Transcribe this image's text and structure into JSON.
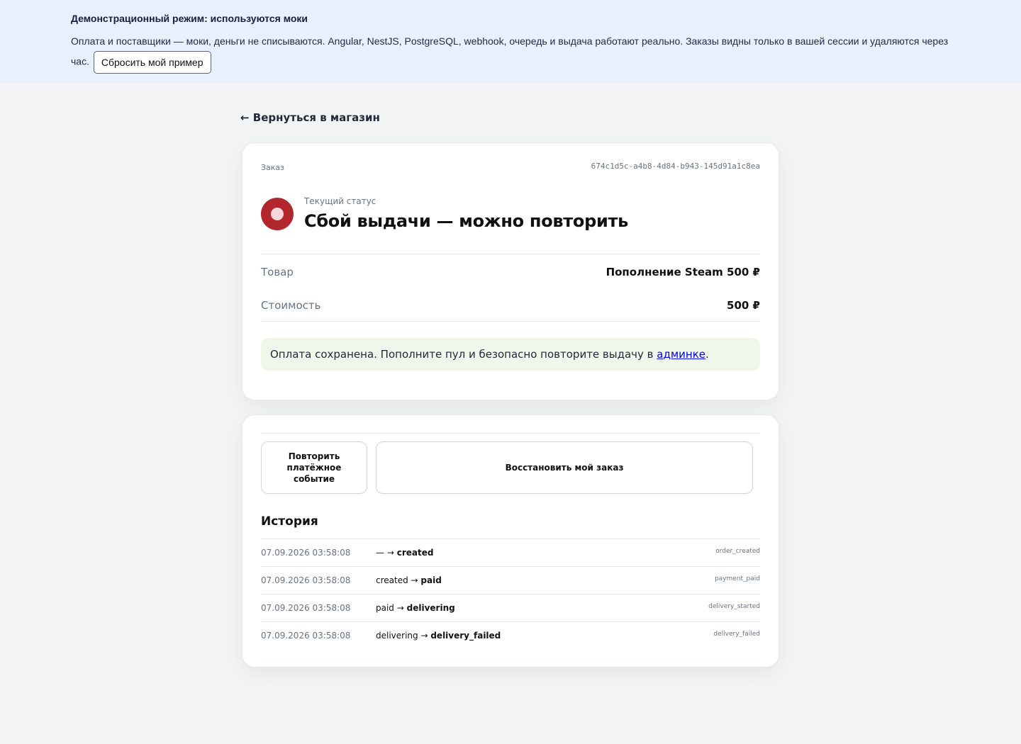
{
  "banner": {
    "title": "Демонстрационный режим: используются моки",
    "text": "Оплата и поставщики — моки, деньги не списываются. Angular, NestJS, PostgreSQL, webhook, очередь и выдача работают реально. Заказы видны только в вашей сессии и удаляются через час.",
    "reset_label": "Сбросить мой пример"
  },
  "nav": {
    "back_label": "← Вернуться в магазин"
  },
  "order": {
    "label": "Заказ",
    "id": "674c1d5c-a4b8-4d84-b943-145d91a1c8ea",
    "status_caption": "Текущий статус",
    "status_title": "Сбой выдачи — можно повторить",
    "status_color": "#b3262d",
    "product_label": "Товар",
    "product_value": "Пополнение Steam 500 ₽",
    "price_label": "Стоимость",
    "price_value": "500 ₽",
    "notice_text": "Оплата сохранена. Пополните пул и безопасно повторите выдачу в ",
    "notice_link": "админке",
    "notice_end": "."
  },
  "actions": {
    "retry_payment_label": "Повторить платёжное событие",
    "restore_order_label": "Восстановить мой заказ"
  },
  "history": {
    "title": "История",
    "rows": [
      {
        "date": "07.09.2026 03:58:08",
        "from": "— →",
        "to": "created",
        "event": "order_created"
      },
      {
        "date": "07.09.2026 03:58:08",
        "from": "created →",
        "to": "paid",
        "event": "payment_paid"
      },
      {
        "date": "07.09.2026 03:58:08",
        "from": "paid →",
        "to": "delivering",
        "event": "delivery_started"
      },
      {
        "date": "07.09.2026 03:58:08",
        "from": "delivering →",
        "to": "delivery_failed",
        "event": "delivery_failed"
      }
    ]
  }
}
